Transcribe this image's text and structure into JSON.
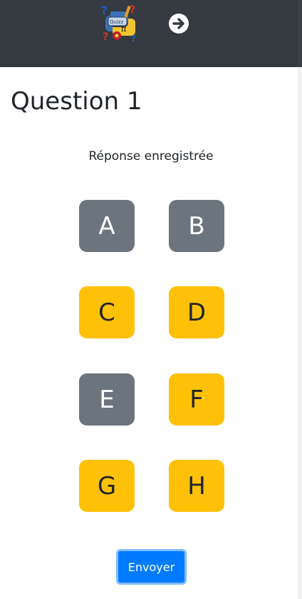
{
  "header": {
    "logo_icon": "quiz-logo-icon",
    "next_icon": "arrow-right-circle-icon",
    "bg_color": "#343a40"
  },
  "question": {
    "title": "Question 1",
    "status": "Réponse enregistrée"
  },
  "options": [
    {
      "label": "A",
      "state": "grey"
    },
    {
      "label": "B",
      "state": "grey"
    },
    {
      "label": "C",
      "state": "yellow"
    },
    {
      "label": "D",
      "state": "yellow"
    },
    {
      "label": "E",
      "state": "grey"
    },
    {
      "label": "F",
      "state": "yellow"
    },
    {
      "label": "G",
      "state": "yellow"
    },
    {
      "label": "H",
      "state": "yellow"
    }
  ],
  "colors": {
    "grey": "#6c757d",
    "yellow": "#ffc107",
    "primary": "#007bff"
  },
  "submit": {
    "label": "Envoyer"
  }
}
